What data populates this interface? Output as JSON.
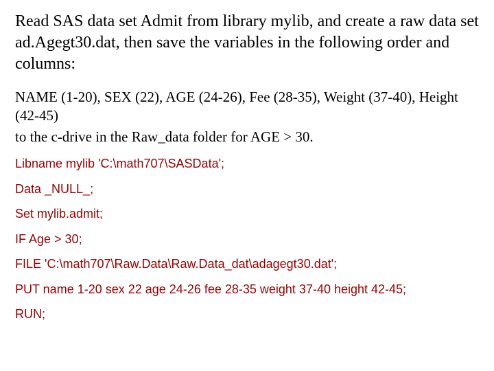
{
  "intro": "Read SAS data set Admit from library mylib, and create a raw data set ad.Agegt30.dat, then save  the variables in the following order and columns:",
  "cols": "NAME (1-20), SEX (22), AGE (24-26), Fee (28-35), Weight (37-40), Height (42-45)",
  "dest": "to the c-drive in the Raw_data folder for AGE > 30.",
  "code": {
    "l1": "Libname  mylib  'C:\\math707\\SASData';",
    "l2": "Data _NULL_;",
    "l3": "Set mylib.admit;",
    "l4": "IF Age > 30;",
    "l5": "FILE 'C:\\math707\\Raw.Data\\Raw.Data_dat\\adagegt30.dat';",
    "l6": "PUT name  1-20 sex  22 age 24-26 fee 28-35 weight 37-40 height 42-45;",
    "l7": "RUN;"
  }
}
